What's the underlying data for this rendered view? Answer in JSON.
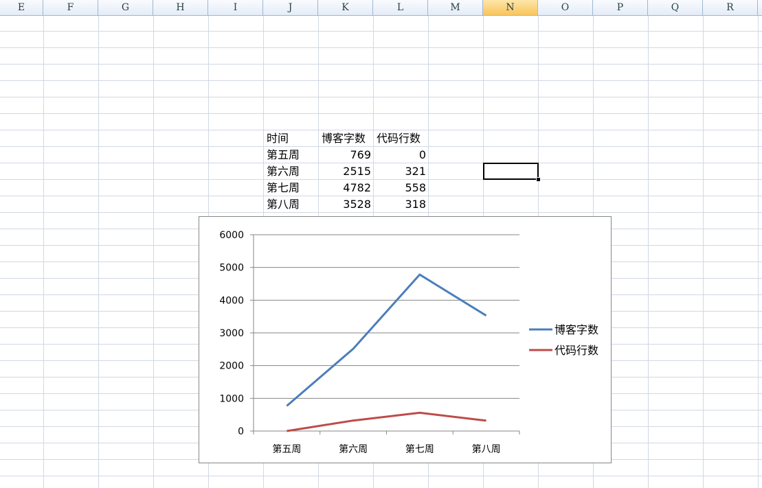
{
  "columns": [
    "E",
    "F",
    "G",
    "H",
    "I",
    "J",
    "K",
    "L",
    "M",
    "N",
    "O",
    "P",
    "Q",
    "R"
  ],
  "selected_column": "N",
  "table": {
    "headers": [
      "时间",
      "博客字数",
      "代码行数"
    ],
    "rows": [
      [
        "第五周",
        "769",
        "0"
      ],
      [
        "第六周",
        "2515",
        "321"
      ],
      [
        "第七周",
        "4782",
        "558"
      ],
      [
        "第八周",
        "3528",
        "318"
      ]
    ]
  },
  "chart_data": {
    "type": "line",
    "categories": [
      "第五周",
      "第六周",
      "第七周",
      "第八周"
    ],
    "series": [
      {
        "name": "博客字数",
        "values": [
          769,
          2515,
          4782,
          3528
        ],
        "color": "#4a7ebb"
      },
      {
        "name": "代码行数",
        "values": [
          0,
          321,
          558,
          318
        ],
        "color": "#be4b48"
      }
    ],
    "ylim": [
      0,
      6000
    ],
    "yticks": [
      "0",
      "1000",
      "2000",
      "3000",
      "4000",
      "5000",
      "6000"
    ],
    "grid": true,
    "legend_position": "right"
  }
}
